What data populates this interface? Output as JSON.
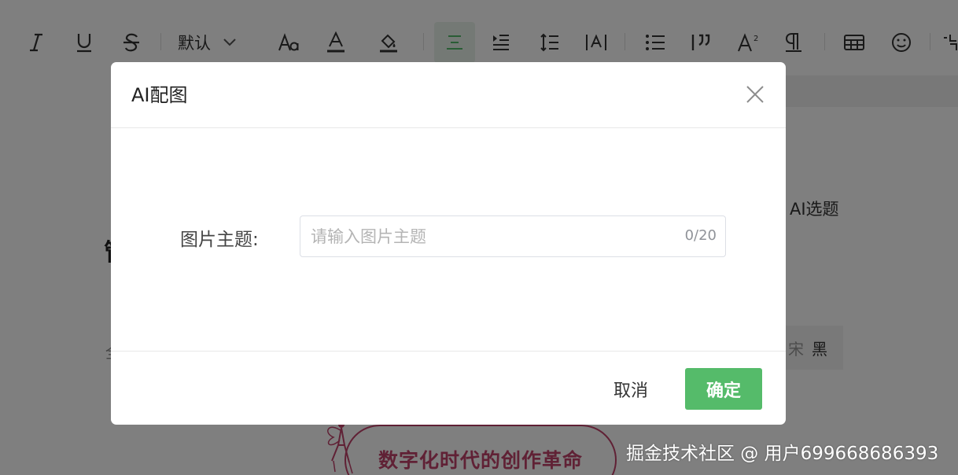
{
  "toolbar": {
    "font_value": "默认",
    "icons": [
      "italic-icon",
      "underline-icon",
      "strikethrough-icon",
      "font-size-icon",
      "font-color-icon",
      "highlight-icon",
      "align-center-icon",
      "indent-icon",
      "line-height-icon",
      "letter-spacing-icon",
      "bullet-list-icon",
      "blockquote-icon",
      "superscript-icon",
      "paragraph-icon",
      "table-icon",
      "emoji-icon"
    ]
  },
  "background": {
    "ai_topic_label": "AI选题",
    "heading_char": "管",
    "faint_char": "全",
    "font_options": [
      "宋",
      "黑"
    ],
    "banner_text": "数字化时代的创作革命"
  },
  "dialog": {
    "title": "AI配图",
    "field_label": "图片主题:",
    "input_value": "",
    "input_placeholder": "请输入图片主题",
    "counter": "0/20",
    "cancel_label": "取消",
    "confirm_label": "确定"
  },
  "colors": {
    "accent_green": "#55bb6a",
    "overlay": "rgba(0,0,0,0.5)",
    "banner_pink": "#c0426b"
  },
  "watermark": "掘金技术社区 @ 用户699668686393"
}
